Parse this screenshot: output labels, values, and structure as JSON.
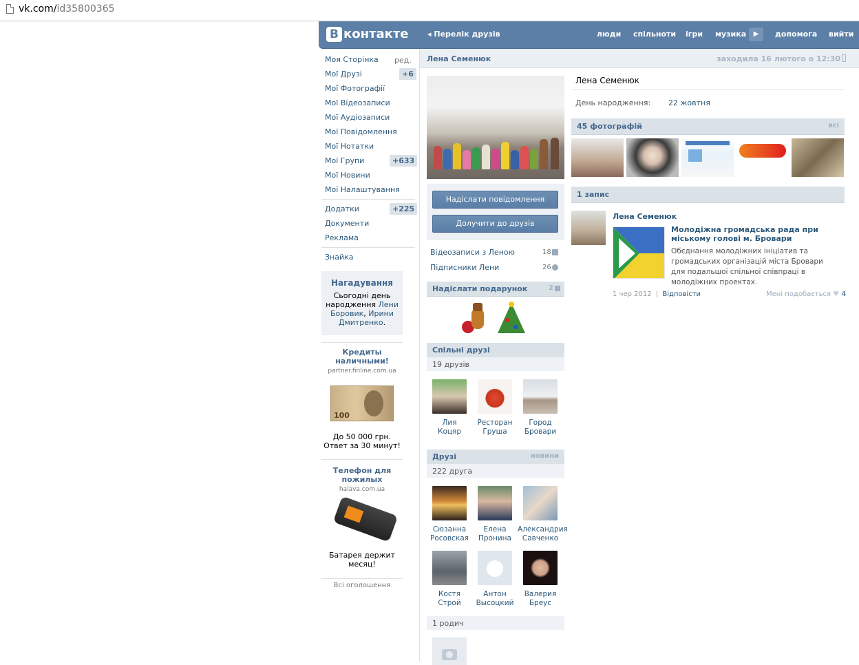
{
  "browser": {
    "url_host": "vk.com/",
    "url_path": "id35800365"
  },
  "header": {
    "logo_letter": "В",
    "logo_text": "контакте",
    "back_label": "Перелік друзів",
    "nav": [
      "люди",
      "спільноти",
      "ігри",
      "музика",
      "допомога",
      "вийти"
    ],
    "play_icon": "play-icon"
  },
  "sidebar": {
    "items": [
      {
        "label": "Моя Сторінка",
        "extra": "ред."
      },
      {
        "label": "Мої Друзі",
        "badge": "+6"
      },
      {
        "label": "Мої Фотографії"
      },
      {
        "label": "Мої Відеозаписи"
      },
      {
        "label": "Мої Аудіозаписи"
      },
      {
        "label": "Мої Повідомлення"
      },
      {
        "label": "Мої Нотатки"
      },
      {
        "label": "Мої Групи",
        "badge": "+633"
      },
      {
        "label": "Мої Новини"
      },
      {
        "label": "Мої Налаштування"
      },
      {
        "label": "Додатки",
        "badge": "+225"
      },
      {
        "label": "Документи"
      },
      {
        "label": "Реклама"
      },
      {
        "label": "Знайка"
      }
    ],
    "reminder": {
      "title": "Нагадування",
      "text_1": "Сьогодні день народження",
      "name_1": "Лени Боровик",
      "sep": ",",
      "name_2": "Ирини Дмитренко",
      "end": "."
    },
    "ads": [
      {
        "title": "Кредиты наличными!",
        "domain": "partner.finline.com.ua",
        "text": "До 50 000 грн. Ответ за 30 минут!"
      },
      {
        "title": "Телефон для пожилых",
        "domain": "halava.com.ua",
        "text": "Батарея держит месяц!"
      }
    ],
    "all_ads": "Всі оголошення"
  },
  "profile": {
    "name": "Лена Семенюк",
    "status": "заходила 16 лютого о 12:30",
    "send_message": "Надіслати повідомлення",
    "add_friend": "Долучити до друзів",
    "videos_label": "Відеозаписи з Леною",
    "videos_count": "18",
    "followers_label": "Підписники Лени",
    "followers_count": "26",
    "gift_title": "Надіслати подарунок",
    "gift_count": "2",
    "common_title": "Спільні друзі",
    "common_count": "19 друзів",
    "common_friends": [
      {
        "first": "Лия",
        "last": "Коцяр"
      },
      {
        "first": "Ресторан",
        "last": "Груша"
      },
      {
        "first": "Город",
        "last": "Бровари"
      }
    ],
    "friends_title": "Друзі",
    "friends_news": "новини",
    "friends_count": "222 друга",
    "friends": [
      {
        "first": "Сюзанна",
        "last": "Росовская"
      },
      {
        "first": "Елена",
        "last": "Пронина"
      },
      {
        "first": "Александрия",
        "last": "Савченко"
      },
      {
        "first": "Костя",
        "last": "Строй"
      },
      {
        "first": "Антон",
        "last": "Высоцкий"
      },
      {
        "first": "Валерия",
        "last": "Бреус"
      }
    ],
    "relatives": "1 родич",
    "birthday_label": "День народження:",
    "birthday_value": "22 жовтня",
    "photos_title": "45 фотографій",
    "photos_all": "всі",
    "posts_title": "1 запис",
    "post": {
      "author": "Лена Семенюк",
      "title": "Молодіжна громадська рада при міському голові м. Бровари",
      "desc": "Обєднання молодіжних ініціатив та громадських організацій міста Бровари для подальшої спільної співпраці в молодіжних проектах.",
      "date": "1 чер 2012",
      "sep": "|",
      "reply": "Відповісти",
      "like_label": "Мені подобається",
      "like_count": "4"
    }
  },
  "colors": {
    "header": "#5b7fa6",
    "link": "#2b587a",
    "section": "#dae2e8",
    "accent": "#45688e"
  }
}
